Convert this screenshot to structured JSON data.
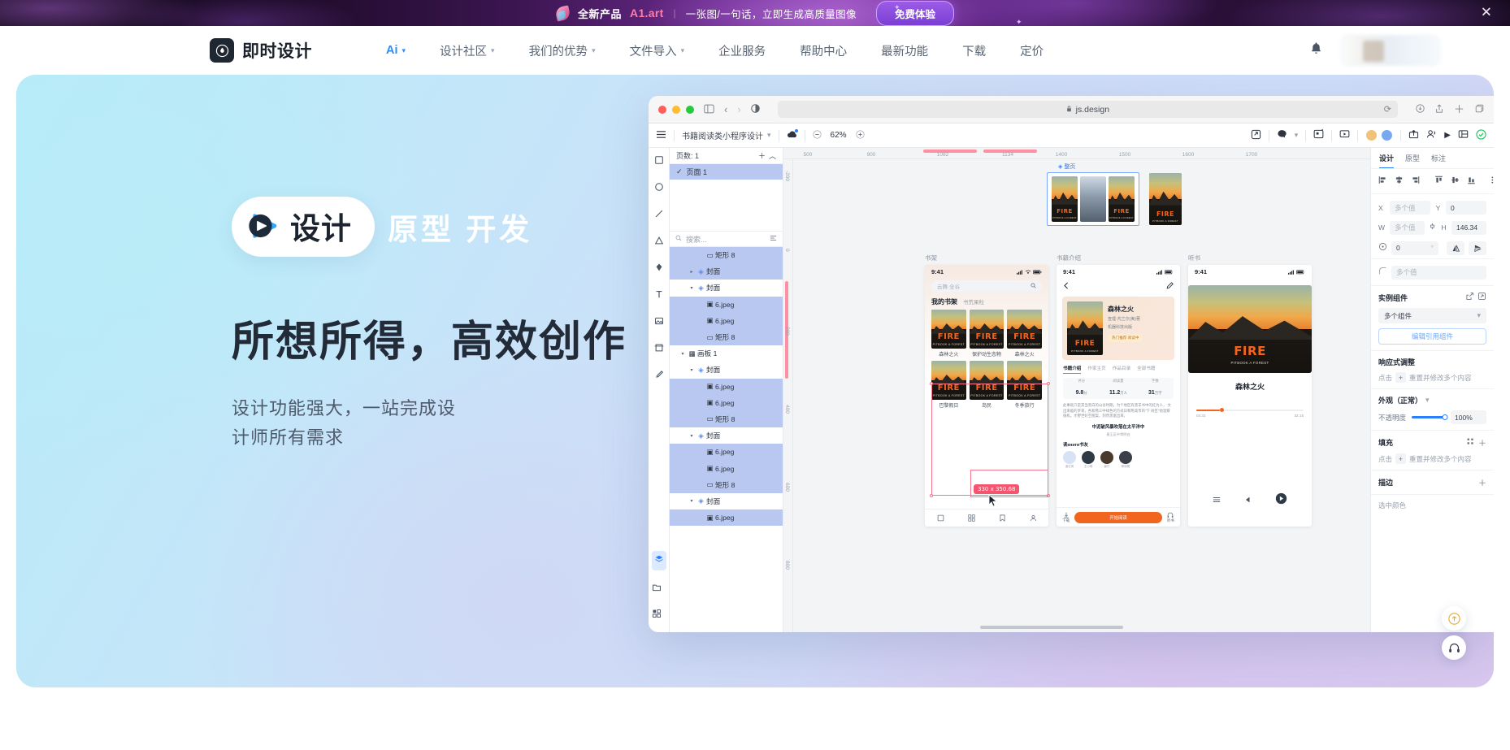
{
  "promo": {
    "logo_icon": "a1-art-logo-icon",
    "headline": "全新产品",
    "brand": "A1.art",
    "divider": "|",
    "tagline": "一张图/一句话，立即生成高质量图像",
    "cta_label": "免费体验",
    "close_icon": "close-icon",
    "accent_color": "#ff7ea8",
    "cta_color": "#8b4ce0"
  },
  "header": {
    "brand_mark_icon": "jishi-logo-icon",
    "brand_name": "即时设计",
    "nav": [
      {
        "label": "Ai",
        "has_caret": true,
        "accent": true
      },
      {
        "label": "设计社区",
        "has_caret": true,
        "accent": false
      },
      {
        "label": "我们的优势",
        "has_caret": true,
        "accent": false
      },
      {
        "label": "文件导入",
        "has_caret": true,
        "accent": false
      },
      {
        "label": "企业服务",
        "has_caret": false,
        "accent": false
      },
      {
        "label": "帮助中心",
        "has_caret": false,
        "accent": false
      },
      {
        "label": "最新功能",
        "has_caret": false,
        "accent": false
      },
      {
        "label": "下载",
        "has_caret": false,
        "accent": false
      },
      {
        "label": "定价",
        "has_caret": false,
        "accent": false
      }
    ],
    "bell_icon": "notification-bell-icon",
    "account_icon": "account-area"
  },
  "hero": {
    "pill_icon": "play-badge-icon",
    "pill_label": "设计",
    "line1_rest": "原型 开发",
    "headline": "所想所得，高效创作",
    "sub_line1": "设计功能强大，一站完成设",
    "sub_line2": "计师所有需求"
  },
  "app": {
    "browser": {
      "url": "js.design",
      "lock_icon": "lock-icon",
      "back_icon": "chevron-left-icon",
      "forward_icon": "chevron-right-icon",
      "sidebar_icon": "sidebar-toggle-icon",
      "contrast_icon": "contrast-icon",
      "reload_icon": "reload-icon",
      "share_icon": "share-icon",
      "newtab_icon": "plus-icon",
      "tabs_icon": "tabs-icon"
    },
    "toolbar": {
      "menu_icon": "hamburger-menu-icon",
      "doc_title": "书籍阅读类小程序设计",
      "doc_caret_icon": "chevron-down-icon",
      "cloud_icon": "saved-cloud-icon",
      "zoom_out_icon": "minus-icon",
      "zoom_value": "62%",
      "zoom_in_icon": "plus-icon",
      "export_icon": "export-icon",
      "comment_icon": "comment-icon",
      "present_icon": "present-icon",
      "layout_icon": "layout-icon",
      "share_icon": "share-icon",
      "members_icon": "members-icon",
      "play_icon": "play-icon",
      "grid_icon": "grid-icon",
      "check_icon": "check-circle-icon"
    },
    "tools": [
      "move-tool-icon",
      "rect-tool-icon",
      "ellipse-tool-icon",
      "line-tool-icon",
      "polygon-tool-icon",
      "pen-tool-icon",
      "text-tool-icon",
      "image-tool-icon",
      "frame-tool-icon",
      "brush-tool-icon"
    ],
    "tools_bottom": [
      "layers-icon",
      "assets-icon",
      "components-icon"
    ],
    "pages": {
      "count_label": "页数: 1",
      "add_icon": "plus-icon",
      "collapse_icon": "chevron-up-icon",
      "items": [
        {
          "label": "页面 1",
          "selected": true,
          "check_icon": "check-icon"
        }
      ]
    },
    "layers_search": {
      "placeholder": "搜索...",
      "search_icon": "search-icon",
      "filter_icon": "filter-icon"
    },
    "layers": [
      {
        "name": "矩形 8",
        "icon": "rect-layer-icon",
        "indent": 3,
        "selected": true,
        "arrow": ""
      },
      {
        "name": "封面",
        "icon": "component-layer-icon",
        "indent": 2,
        "selected": true,
        "arrow": "▸"
      },
      {
        "name": "封面",
        "icon": "component-layer-icon",
        "indent": 2,
        "selected": false,
        "arrow": "▾"
      },
      {
        "name": "6.jpeg",
        "icon": "image-layer-icon",
        "indent": 3,
        "selected": true,
        "arrow": ""
      },
      {
        "name": "6.jpeg",
        "icon": "image-layer-icon",
        "indent": 3,
        "selected": true,
        "arrow": ""
      },
      {
        "name": "矩形 8",
        "icon": "rect-layer-icon",
        "indent": 3,
        "selected": true,
        "arrow": ""
      },
      {
        "name": "画板 1",
        "icon": "frame-layer-icon",
        "indent": 1,
        "selected": false,
        "arrow": "▾"
      },
      {
        "name": "封面",
        "icon": "component-layer-icon",
        "indent": 2,
        "selected": false,
        "arrow": "▾"
      },
      {
        "name": "6.jpeg",
        "icon": "image-layer-icon",
        "indent": 3,
        "selected": true,
        "arrow": ""
      },
      {
        "name": "6.jpeg",
        "icon": "image-layer-icon",
        "indent": 3,
        "selected": true,
        "arrow": ""
      },
      {
        "name": "矩形 8",
        "icon": "rect-layer-icon",
        "indent": 3,
        "selected": true,
        "arrow": ""
      },
      {
        "name": "封面",
        "icon": "component-layer-icon",
        "indent": 2,
        "selected": false,
        "arrow": "▾"
      },
      {
        "name": "6.jpeg",
        "icon": "image-layer-icon",
        "indent": 3,
        "selected": true,
        "arrow": ""
      },
      {
        "name": "6.jpeg",
        "icon": "image-layer-icon",
        "indent": 3,
        "selected": true,
        "arrow": ""
      },
      {
        "name": "矩形 8",
        "icon": "rect-layer-icon",
        "indent": 3,
        "selected": true,
        "arrow": ""
      },
      {
        "name": "封面",
        "icon": "component-layer-icon",
        "indent": 2,
        "selected": false,
        "arrow": "▾"
      },
      {
        "name": "6.jpeg",
        "icon": "image-layer-icon",
        "indent": 3,
        "selected": true,
        "arrow": ""
      }
    ],
    "canvas": {
      "ruler_x": [
        "500",
        "900",
        "1082",
        "1134",
        "1400",
        "1500",
        "1600",
        "1700"
      ],
      "ruler_y": [
        "-200",
        "0",
        "200",
        "400",
        "600",
        "800"
      ],
      "group_tag": "整页",
      "group_icon": "frame-icon",
      "selection_size": "330 x 350.68",
      "cursor_icon": "cursor-arrow-icon",
      "frames": [
        {
          "label": "书架",
          "status_time": "9:41",
          "search_placeholder": "云舞·全谷",
          "section_title": "我的书架",
          "section_sub": "书荒果粒",
          "books_row1": [
            "森林之火",
            "保护动生态物",
            "森林之火"
          ],
          "books_row2": [
            "巴黎假日",
            "岛民",
            "冬季旅行"
          ],
          "tabs": [
            "书架",
            "发现",
            "书单",
            "我的"
          ],
          "book_title": "FIRE",
          "book_sub": "PITBOOK A FOREST"
        },
        {
          "label": "书籍介绍",
          "status_time": "9:41",
          "title": "森林之火",
          "author": "查理·芃兰尔(美)著",
          "pub": "机器科技出版",
          "badge": "热门推荐 阅读中",
          "nav": [
            "书籍介绍",
            "作家主页",
            "作品目录",
            "全部书籍"
          ],
          "stats": [
            {
              "value": "9.8",
              "unit": "分",
              "label": "评分"
            },
            {
              "value": "11.2",
              "unit": "万人",
              "label": "阅读量"
            },
            {
              "value": "31",
              "unit": "万字",
              "label": "字数"
            }
          ],
          "friends_label": "读книги书友",
          "friend_names": [
            "追忆风",
            "王小明",
            "豪仔",
            "咪咪尾"
          ],
          "download_label": "下载",
          "read_label": "开始阅读",
          "listen_label": "听书"
        },
        {
          "label": "听书",
          "status_time": "9:41",
          "title": "森林之火",
          "time": "04:32",
          "play_icon": "play-circle-icon"
        }
      ]
    },
    "props": {
      "tabs": [
        {
          "label": "设计",
          "active": true
        },
        {
          "label": "原型",
          "active": false
        },
        {
          "label": "标注",
          "active": false
        }
      ],
      "align_icons": [
        "align-left-icon",
        "align-center-h-icon",
        "align-right-icon",
        "align-top-icon",
        "align-center-v-icon",
        "align-bottom-icon",
        "distribute-icon"
      ],
      "x_label": "X",
      "x_value": "多个值",
      "y_label": "Y",
      "y_value": "0",
      "w_label": "W",
      "w_value": "多个值",
      "h_label": "H",
      "h_value": "146.34",
      "link_icon": "link-ratio-icon",
      "rotation_icon": "rotation-icon",
      "rotation_value": "0",
      "rotation_unit": "°",
      "flip_h_icon": "flip-horizontal-icon",
      "flip_v_icon": "flip-vertical-icon",
      "corner_icon": "corner-radius-icon",
      "corner_value": "多个值",
      "instance": {
        "title": "实例组件",
        "detach_icon": "detach-icon",
        "goto_icon": "goto-main-icon",
        "select_value": "多个组件",
        "edit_label": "编辑引用组件"
      },
      "responsive": {
        "title": "响应式调整",
        "hint_pre": "点击",
        "plus": "+",
        "hint_post": "重置并修改多个内容"
      },
      "appearance": {
        "title": "外观（正常）",
        "caret_icon": "chevron-down-icon",
        "opacity_label": "不透明度",
        "opacity_value": "100",
        "opacity_unit": "%"
      },
      "fill": {
        "title": "填充",
        "style_icon": "style-icon",
        "add_icon": "plus-icon",
        "hint_pre": "点击",
        "plus": "+",
        "hint_post": "重置并修改多个内容"
      },
      "stroke": {
        "title": "描边",
        "add_icon": "plus-icon"
      },
      "selected_color": {
        "title": "选中颜色"
      }
    },
    "fabs": [
      "scroll-top-icon",
      "headset-support-icon"
    ]
  }
}
